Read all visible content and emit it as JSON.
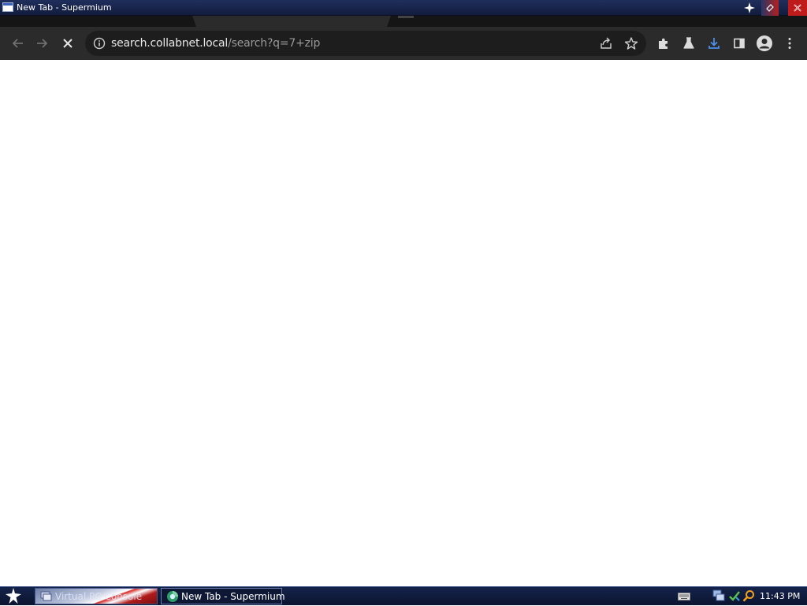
{
  "window": {
    "title": "New Tab - Supermium",
    "buttons": {
      "pin_icon": "star-pin-icon",
      "shade_icon": "shade-icon",
      "close_icon": "close-icon"
    }
  },
  "browser": {
    "omnibox": {
      "url_host": "search.collabnet.local",
      "url_path": "/search?q=7+zip"
    },
    "toolbar_icons": [
      "back-arrow-icon",
      "forward-arrow-icon",
      "stop-loading-icon",
      "site-info-icon",
      "share-icon",
      "bookmark-star-icon",
      "extensions-icon",
      "labs-flask-icon",
      "download-icon",
      "side-panel-icon",
      "profile-avatar-icon",
      "menu-kebab-icon"
    ],
    "colors": {
      "toolbar": "#2b2b2b",
      "omnibox": "#1d1d1d",
      "download_accent": "#4a8de8"
    }
  },
  "taskbar": {
    "tasks": [
      {
        "label": "Virtual PC Console",
        "icon": "virtual-pc-icon"
      },
      {
        "label": "New Tab - Supermium",
        "icon": "supermium-icon"
      }
    ],
    "tray_icons": [
      "keyboard-icon",
      "network-icon",
      "update-icon",
      "search-magnifier-icon"
    ],
    "clock": "11:43 PM"
  }
}
